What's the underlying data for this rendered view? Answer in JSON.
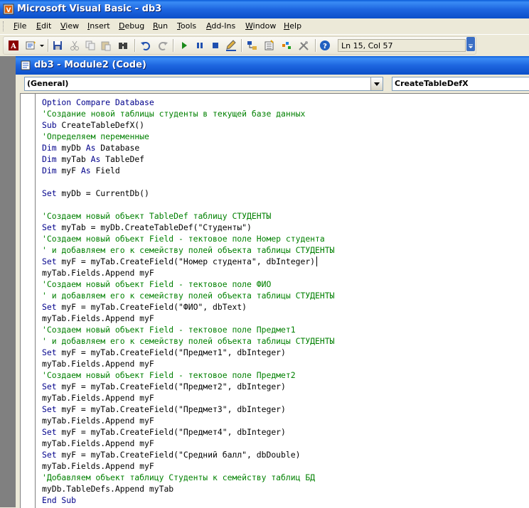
{
  "app": {
    "title": "Microsoft Visual Basic - db3"
  },
  "menu": [
    {
      "key": "F",
      "rest": "ile"
    },
    {
      "key": "E",
      "rest": "dit"
    },
    {
      "key": "V",
      "rest": "iew"
    },
    {
      "key": "I",
      "rest": "nsert"
    },
    {
      "key": "D",
      "rest": "ebug"
    },
    {
      "key": "R",
      "rest": "un"
    },
    {
      "key": "T",
      "rest": "ools"
    },
    {
      "key": "A",
      "rest": "dd-Ins"
    },
    {
      "key": "W",
      "rest": "indow"
    },
    {
      "key": "H",
      "rest": "elp"
    }
  ],
  "toolbar": {
    "status": "Ln 15, Col 57",
    "icons": [
      "access-icon",
      "insert-module-icon",
      "save-icon",
      "cut-icon",
      "copy-icon",
      "paste-icon",
      "find-icon",
      "undo-icon",
      "redo-icon",
      "run-icon",
      "break-icon",
      "reset-icon",
      "design-mode-icon",
      "project-explorer-icon",
      "properties-icon",
      "object-browser-icon",
      "toolbox-icon",
      "help-icon"
    ]
  },
  "code_window": {
    "title": "db3 - Module2 (Code)",
    "object_combo": "(General)",
    "proc_combo": "CreateTableDefX"
  },
  "code_lines": [
    [
      [
        "Option Compare Database",
        "kw"
      ]
    ],
    [
      [
        "'Создание новой таблицы студенты в текущей базе данных",
        "cm"
      ]
    ],
    [
      [
        "Sub",
        "kw"
      ],
      [
        " CreateTableDefX()",
        ""
      ]
    ],
    [
      [
        "'Определяем переменные",
        "cm"
      ]
    ],
    [
      [
        "Dim",
        "kw"
      ],
      [
        " myDb ",
        ""
      ],
      [
        "As",
        "kw"
      ],
      [
        " Database",
        ""
      ]
    ],
    [
      [
        "Dim",
        "kw"
      ],
      [
        " myTab ",
        ""
      ],
      [
        "As",
        "kw"
      ],
      [
        " TableDef",
        ""
      ]
    ],
    [
      [
        "Dim",
        "kw"
      ],
      [
        " myF ",
        ""
      ],
      [
        "As",
        "kw"
      ],
      [
        " Field",
        ""
      ]
    ],
    [],
    [
      [
        "Set",
        "kw"
      ],
      [
        " myDb = CurrentDb()",
        ""
      ]
    ],
    [],
    [
      [
        "'Создаем новый объект TableDef таблицу СТУДЕНТЫ",
        "cm"
      ]
    ],
    [
      [
        "Set",
        "kw"
      ],
      [
        " myTab = myDb.CreateTableDef(\"Студенты\")",
        ""
      ]
    ],
    [
      [
        "'Создаем новый объект Field - тектовое поле Номер студента",
        "cm"
      ]
    ],
    [
      [
        "' и добавляем его к семейству полей объекта таблицы СТУДЕНТЫ",
        "cm"
      ]
    ],
    [
      [
        "Set",
        "kw"
      ],
      [
        " myF = myTab.CreateField(\"Номер студента\", dbInteger)",
        ""
      ],
      [
        "",
        "caret"
      ]
    ],
    [
      [
        "myTab.Fields.Append myF",
        ""
      ]
    ],
    [
      [
        "'Создаем новый объект Field - тектовое поле ФИО",
        "cm"
      ]
    ],
    [
      [
        "' и добавляем его к семейству полей объекта таблицы СТУДЕНТЫ",
        "cm"
      ]
    ],
    [
      [
        "Set",
        "kw"
      ],
      [
        " myF = myTab.CreateField(\"ФИО\", dbText)",
        ""
      ]
    ],
    [
      [
        "myTab.Fields.Append myF",
        ""
      ]
    ],
    [
      [
        "'Создаем новый объект Field - тектовое поле Предмет1",
        "cm"
      ]
    ],
    [
      [
        "' и добавляем его к семейству полей объекта таблицы СТУДЕНТЫ",
        "cm"
      ]
    ],
    [
      [
        "Set",
        "kw"
      ],
      [
        " myF = myTab.CreateField(\"Предмет1\", dbInteger)",
        ""
      ]
    ],
    [
      [
        "myTab.Fields.Append myF",
        ""
      ]
    ],
    [
      [
        "'Создаем новый объект Field - тектовое поле Предмет2",
        "cm"
      ]
    ],
    [
      [
        "Set",
        "kw"
      ],
      [
        " myF = myTab.CreateField(\"Предмет2\", dbInteger)",
        ""
      ]
    ],
    [
      [
        "myTab.Fields.Append myF",
        ""
      ]
    ],
    [
      [
        "Set",
        "kw"
      ],
      [
        " myF = myTab.CreateField(\"Предмет3\", dbInteger)",
        ""
      ]
    ],
    [
      [
        "myTab.Fields.Append myF",
        ""
      ]
    ],
    [
      [
        "Set",
        "kw"
      ],
      [
        " myF = myTab.CreateField(\"Предмет4\", dbInteger)",
        ""
      ]
    ],
    [
      [
        "myTab.Fields.Append myF",
        ""
      ]
    ],
    [
      [
        "Set",
        "kw"
      ],
      [
        " myF = myTab.CreateField(\"Средний балл\", dbDouble)",
        ""
      ]
    ],
    [
      [
        "myTab.Fields.Append myF",
        ""
      ]
    ],
    [
      [
        "'Добавляем объект таблицу Студенты к семейству таблиц БД",
        "cm"
      ]
    ],
    [
      [
        "myDb.TableDefs.Append myTab",
        ""
      ]
    ],
    [
      [
        "End Sub",
        "kw"
      ]
    ]
  ],
  "colors": {
    "keyword": "#00008B",
    "comment": "#008000",
    "titlebar": "#0A5BD8"
  }
}
